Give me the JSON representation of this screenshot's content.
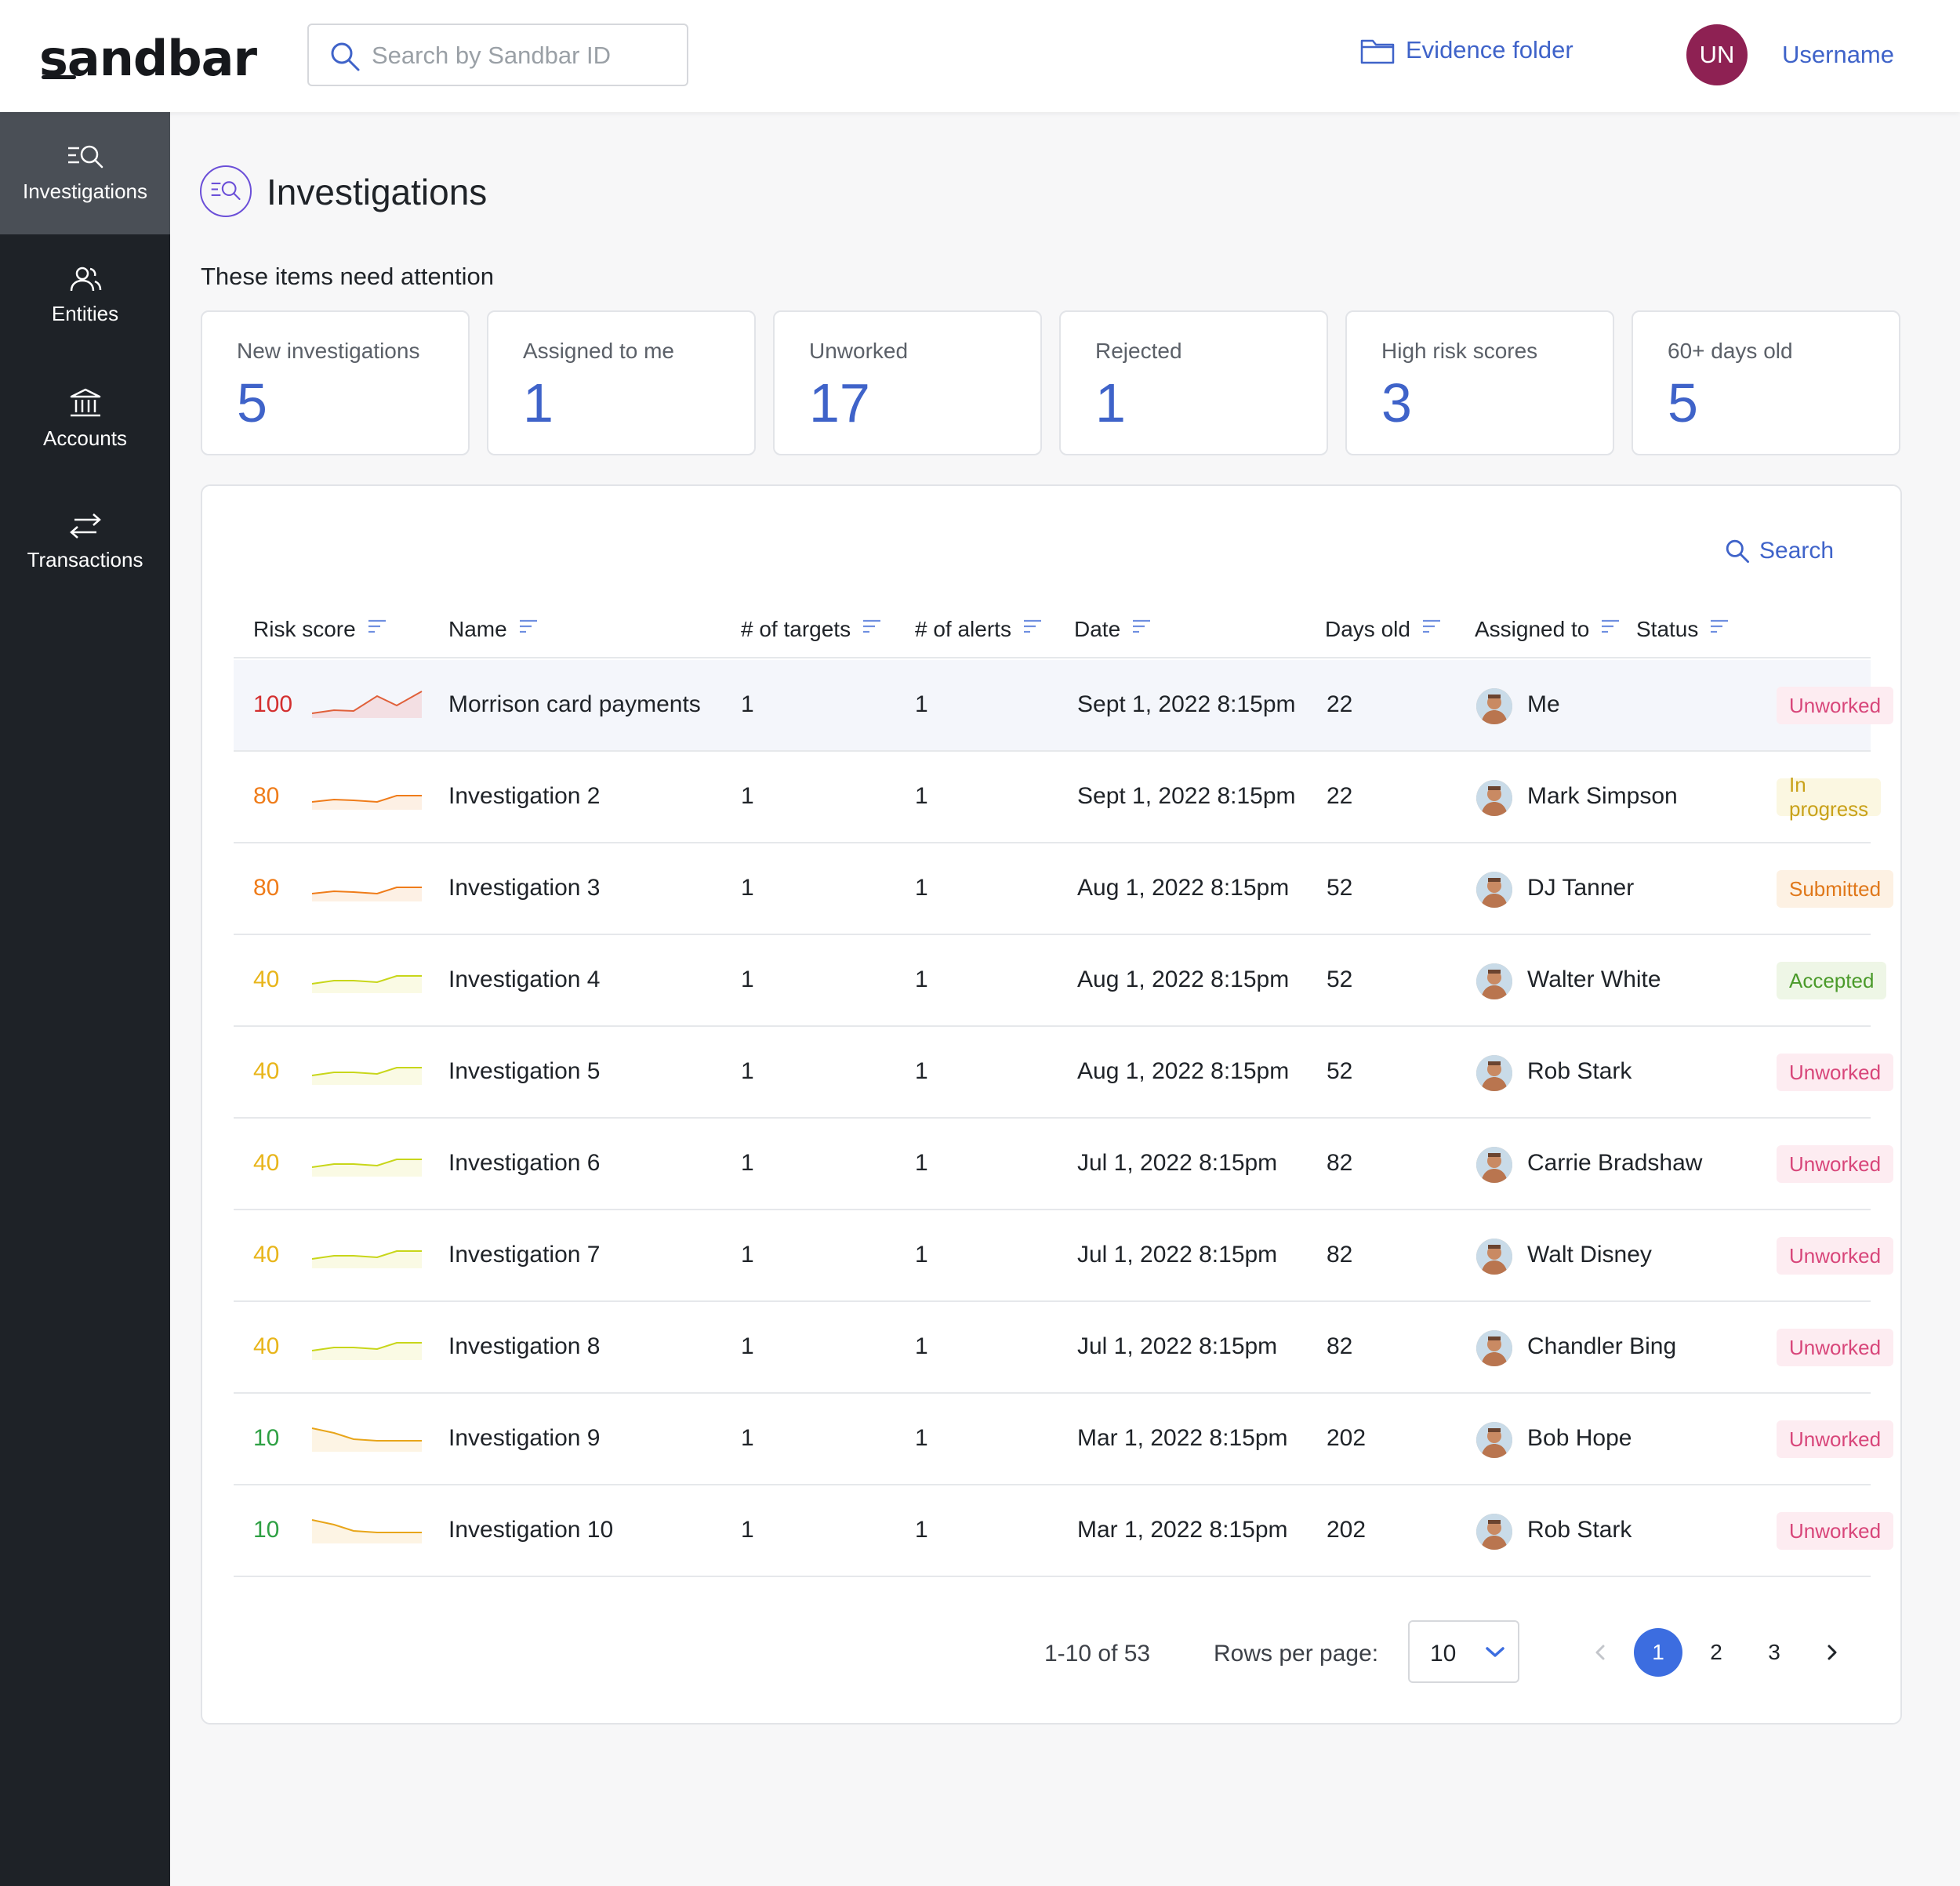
{
  "header": {
    "logo": "sandbar",
    "search_placeholder": "Search by Sandbar ID",
    "evidence_label": "Evidence folder",
    "user_initials": "UN",
    "username": "Username"
  },
  "sidebar": {
    "items": [
      {
        "label": "Investigations",
        "icon": "investigations-icon",
        "active": true
      },
      {
        "label": "Entities",
        "icon": "entities-icon",
        "active": false
      },
      {
        "label": "Accounts",
        "icon": "bank-icon",
        "active": false
      },
      {
        "label": "Transactions",
        "icon": "transfer-arrows-icon",
        "active": false
      }
    ]
  },
  "page": {
    "title": "Investigations",
    "attention_heading": "These items need attention"
  },
  "cards": [
    {
      "label": "New investigations",
      "value": "5"
    },
    {
      "label": "Assigned to me",
      "value": "1"
    },
    {
      "label": "Unworked",
      "value": "17"
    },
    {
      "label": "Rejected",
      "value": "1"
    },
    {
      "label": "High risk scores",
      "value": "3"
    },
    {
      "label": "60+ days old",
      "value": "5"
    }
  ],
  "table": {
    "search_label": "Search",
    "columns": [
      "Risk score",
      "Name",
      "# of targets",
      "# of alerts",
      "Date",
      "Days old",
      "Assigned to",
      "Status"
    ],
    "rows": [
      {
        "risk": "100",
        "name": "Morrison card payments",
        "targets": "1",
        "alerts": "1",
        "date": "Sept 1, 2022 8:15pm",
        "days": "22",
        "assignee": "Me",
        "status": "Unworked"
      },
      {
        "risk": "80",
        "name": "Investigation 2",
        "targets": "1",
        "alerts": "1",
        "date": "Sept 1, 2022 8:15pm",
        "days": "22",
        "assignee": "Mark Simpson",
        "status": "In progress"
      },
      {
        "risk": "80",
        "name": "Investigation 3",
        "targets": "1",
        "alerts": "1",
        "date": "Aug 1, 2022 8:15pm",
        "days": "52",
        "assignee": "DJ Tanner",
        "status": "Submitted"
      },
      {
        "risk": "40",
        "name": "Investigation 4",
        "targets": "1",
        "alerts": "1",
        "date": "Aug 1, 2022 8:15pm",
        "days": "52",
        "assignee": "Walter White",
        "status": "Accepted"
      },
      {
        "risk": "40",
        "name": "Investigation 5",
        "targets": "1",
        "alerts": "1",
        "date": "Aug 1, 2022 8:15pm",
        "days": "52",
        "assignee": "Rob Stark",
        "status": "Unworked"
      },
      {
        "risk": "40",
        "name": "Investigation 6",
        "targets": "1",
        "alerts": "1",
        "date": "Jul 1, 2022 8:15pm",
        "days": "82",
        "assignee": "Carrie Bradshaw",
        "status": "Unworked"
      },
      {
        "risk": "40",
        "name": "Investigation 7",
        "targets": "1",
        "alerts": "1",
        "date": "Jul 1, 2022 8:15pm",
        "days": "82",
        "assignee": "Walt Disney",
        "status": "Unworked"
      },
      {
        "risk": "40",
        "name": "Investigation 8",
        "targets": "1",
        "alerts": "1",
        "date": "Jul 1, 2022 8:15pm",
        "days": "82",
        "assignee": "Chandler Bing",
        "status": "Unworked"
      },
      {
        "risk": "10",
        "name": "Investigation 9",
        "targets": "1",
        "alerts": "1",
        "date": "Mar 1, 2022 8:15pm",
        "days": "202",
        "assignee": "Bob Hope",
        "status": "Unworked"
      },
      {
        "risk": "10",
        "name": "Investigation 10",
        "targets": "1",
        "alerts": "1",
        "date": "Mar 1, 2022 8:15pm",
        "days": "202",
        "assignee": "Rob Stark",
        "status": "Unworked"
      }
    ]
  },
  "pagination": {
    "range": "1-10 of 53",
    "rows_per_page_label": "Rows per page:",
    "rows_per_page": "10",
    "pages": [
      "1",
      "2",
      "3"
    ],
    "current_page": "1"
  },
  "colors": {
    "accent": "#3f63c9",
    "risk_high": "#d32f2f",
    "risk_medium_high": "#ef7c1a",
    "risk_medium": "#e8b51a",
    "risk_low": "#2ea043",
    "status_unworked": "#d8467a",
    "status_in_progress": "#c9a21a",
    "status_submitted": "#e0781a",
    "status_accepted": "#4a9a2a"
  }
}
